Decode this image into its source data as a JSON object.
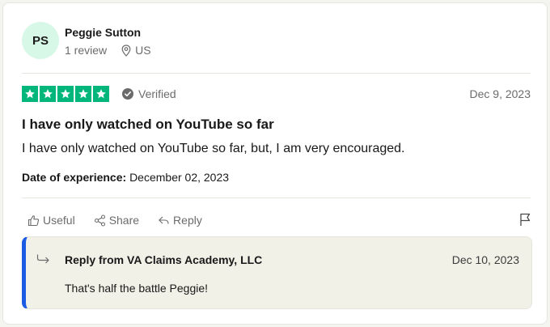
{
  "reviewer": {
    "initials": "PS",
    "name": "Peggie Sutton",
    "review_count": "1 review",
    "country": "US",
    "avatar_color": "#d8f8e7"
  },
  "rating": {
    "stars": 5,
    "max_stars": 5,
    "star_color": "#00b67a",
    "verified_label": "Verified",
    "date": "Dec 9, 2023"
  },
  "review": {
    "title": "I have only watched on YouTube so far",
    "body": "I have only watched on YouTube so far, but, I am very encouraged.",
    "experience_label": "Date of experience:",
    "experience_date": "December 02, 2023"
  },
  "actions": {
    "useful_label": "Useful",
    "share_label": "Share",
    "reply_label": "Reply",
    "report_icon": "flag-icon"
  },
  "reply": {
    "from": "Reply from VA Claims Academy, LLC",
    "date": "Dec 10, 2023",
    "text": "That's half the battle Peggie!",
    "accent_color": "#1c5ce5"
  }
}
